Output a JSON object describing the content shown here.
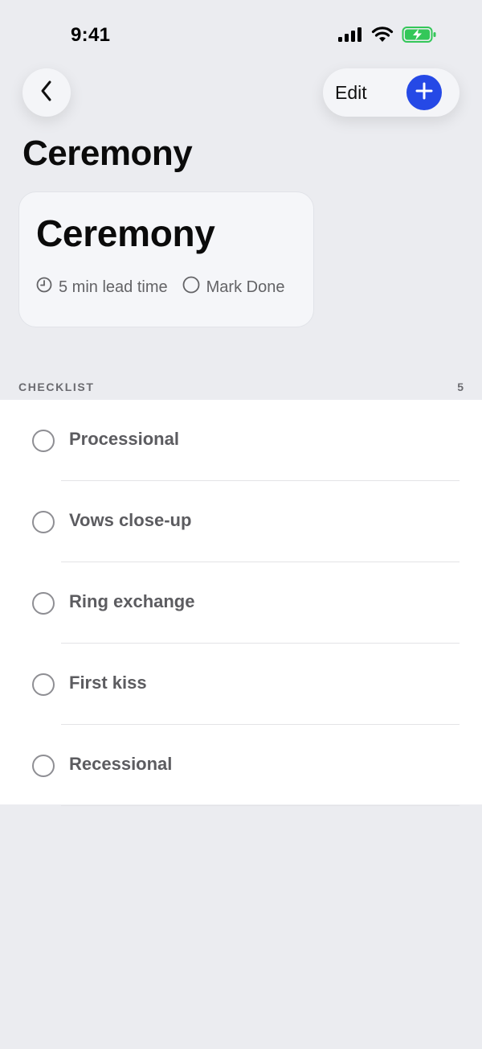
{
  "status_bar": {
    "time": "9:41"
  },
  "nav": {
    "edit_label": "Edit"
  },
  "page": {
    "title": "Ceremony"
  },
  "card": {
    "title": "Ceremony",
    "lead_time": "5 min lead time",
    "mark_done": "Mark Done"
  },
  "checklist": {
    "header": "CHECKLIST",
    "count": "5",
    "items": [
      {
        "label": "Processional"
      },
      {
        "label": "Vows close-up"
      },
      {
        "label": "Ring exchange"
      },
      {
        "label": "First kiss"
      },
      {
        "label": "Recessional"
      }
    ]
  },
  "icons": {
    "back": "chevron-left-icon",
    "add": "plus-icon",
    "clock": "clock-icon",
    "done": "circle-icon",
    "signal": "cellular-signal-icon",
    "wifi": "wifi-icon",
    "battery": "battery-charging-icon"
  },
  "colors": {
    "background": "#ebecf0",
    "accent": "#2549e6",
    "battery": "#34c759",
    "secondary_text": "#636366"
  }
}
